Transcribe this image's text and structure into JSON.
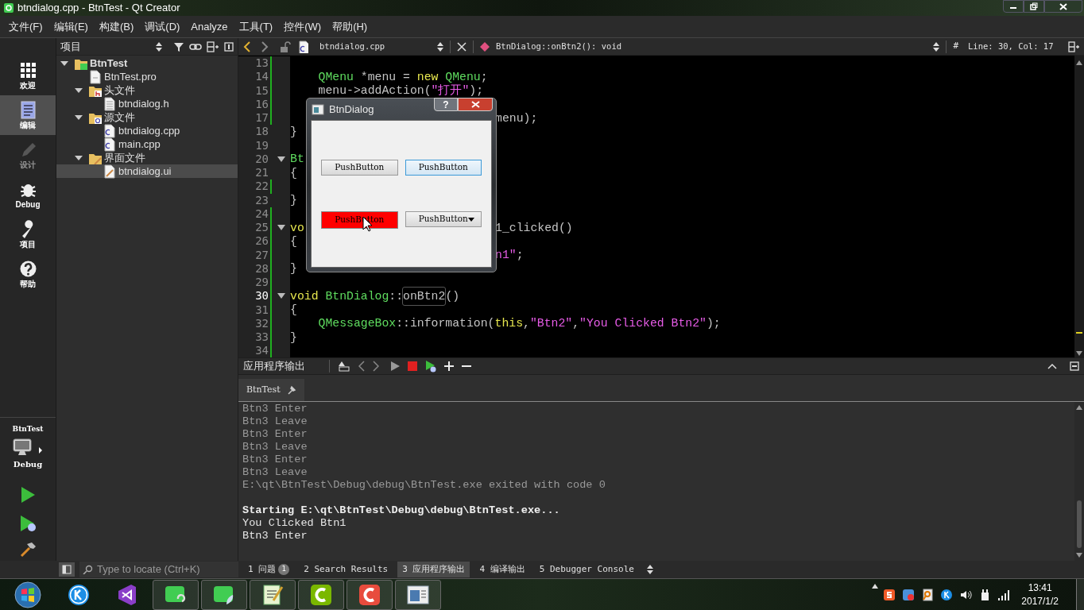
{
  "window": {
    "title": "btndialog.cpp - BtnTest - Qt Creator"
  },
  "menu": [
    "文件(F)",
    "编辑(E)",
    "构建(B)",
    "调试(D)",
    "Analyze",
    "工具(T)",
    "控件(W)",
    "帮助(H)"
  ],
  "mode_bar": {
    "items": [
      {
        "label": "欢迎",
        "kind": "welcome",
        "selected": false,
        "disabled": false
      },
      {
        "label": "编辑",
        "kind": "edit",
        "selected": true,
        "disabled": false
      },
      {
        "label": "设计",
        "kind": "design",
        "selected": false,
        "disabled": true
      },
      {
        "label": "Debug",
        "kind": "debug",
        "selected": false,
        "disabled": false
      },
      {
        "label": "项目",
        "kind": "projects",
        "selected": false,
        "disabled": false
      },
      {
        "label": "帮助",
        "kind": "help",
        "selected": false,
        "disabled": false
      }
    ],
    "target": {
      "project": "BtnTest",
      "config": "Debug"
    }
  },
  "project_panel": {
    "title": "项目",
    "tree": [
      {
        "label": "BtnTest",
        "kind": "project",
        "expanded": true,
        "selected": false,
        "children": [
          {
            "label": "BtnTest.pro",
            "kind": "pro",
            "selected": false
          },
          {
            "label": "头文件",
            "kind": "folder-h",
            "expanded": true,
            "selected": false,
            "children": [
              {
                "label": "btndialog.h",
                "kind": "header",
                "selected": false
              }
            ]
          },
          {
            "label": "源文件",
            "kind": "folder-cpp",
            "expanded": true,
            "selected": false,
            "children": [
              {
                "label": "btndialog.cpp",
                "kind": "cpp",
                "selected": false
              },
              {
                "label": "main.cpp",
                "kind": "cpp",
                "selected": false
              }
            ]
          },
          {
            "label": "界面文件",
            "kind": "folder-ui",
            "expanded": true,
            "selected": false,
            "children": [
              {
                "label": "btndialog.ui",
                "kind": "ui",
                "selected": true
              }
            ]
          }
        ]
      }
    ]
  },
  "editor": {
    "file": "btndialog.cpp",
    "symbol": "BtnDialog::onBtn2(): void",
    "hash": "#",
    "position": "Line: 30, Col: 17",
    "lines": [
      {
        "num": "13",
        "changed": true,
        "foldable": false,
        "current": false
      },
      {
        "num": "14",
        "changed": true,
        "foldable": false,
        "current": false,
        "indented": true,
        "tokens": [
          {
            "kind": "type",
            "text": "QMenu"
          },
          {
            "kind": "plain",
            "text": " *menu = "
          },
          {
            "kind": "keyword",
            "text": "new"
          },
          {
            "kind": "type",
            "text": " QMenu"
          },
          {
            "kind": "plain",
            "text": ";"
          }
        ]
      },
      {
        "num": "15",
        "changed": true,
        "foldable": false,
        "current": false,
        "indented": true,
        "tokens": [
          {
            "kind": "plain",
            "text": "menu->addAction("
          },
          {
            "kind": "string",
            "text": "\"打开\""
          },
          {
            "kind": "plain",
            "text": ");"
          }
        ]
      },
      {
        "num": "16",
        "changed": true,
        "foldable": false,
        "current": false
      },
      {
        "num": "17",
        "changed": true,
        "foldable": false,
        "current": false,
        "after_dialog": [
          {
            "kind": "plain",
            "text": "menu);"
          }
        ]
      },
      {
        "num": "18",
        "changed": false,
        "foldable": false,
        "current": false,
        "tokens": [
          {
            "kind": "plain",
            "text": "}"
          }
        ]
      },
      {
        "num": "19",
        "changed": false,
        "foldable": false,
        "current": false
      },
      {
        "num": "20",
        "changed": false,
        "foldable": true,
        "current": false,
        "tokens": [
          {
            "kind": "type",
            "text": "Bt"
          }
        ]
      },
      {
        "num": "21",
        "changed": false,
        "foldable": false,
        "current": false,
        "tokens": [
          {
            "kind": "plain",
            "text": "{"
          }
        ]
      },
      {
        "num": "22",
        "changed": true,
        "foldable": false,
        "current": false
      },
      {
        "num": "23",
        "changed": false,
        "foldable": false,
        "current": false,
        "tokens": [
          {
            "kind": "plain",
            "text": "}"
          }
        ]
      },
      {
        "num": "24",
        "changed": true,
        "foldable": false,
        "current": false
      },
      {
        "num": "25",
        "changed": true,
        "foldable": true,
        "current": false,
        "tokens": [
          {
            "kind": "keyword",
            "text": "vo"
          }
        ],
        "after_dialog": [
          {
            "kind": "plain",
            "text": "1_clicked()"
          }
        ]
      },
      {
        "num": "26",
        "changed": true,
        "foldable": false,
        "current": false,
        "tokens": [
          {
            "kind": "plain",
            "text": "{"
          }
        ]
      },
      {
        "num": "27",
        "changed": true,
        "foldable": false,
        "current": false,
        "after_dialog": [
          {
            "kind": "string",
            "text": "n1\""
          },
          {
            "kind": "plain",
            "text": ";"
          }
        ]
      },
      {
        "num": "28",
        "changed": true,
        "foldable": false,
        "current": false,
        "tokens": [
          {
            "kind": "plain",
            "text": "}"
          }
        ]
      },
      {
        "num": "29",
        "changed": true,
        "foldable": false,
        "current": false
      },
      {
        "num": "30",
        "changed": true,
        "foldable": true,
        "current": true,
        "tokens": [
          {
            "kind": "keyword",
            "text": "void"
          },
          {
            "kind": "type",
            "text": " BtnDialog"
          },
          {
            "kind": "plain",
            "text": "::"
          },
          {
            "kind": "highlight",
            "text": "onBtn2"
          },
          {
            "kind": "plain",
            "text": "()"
          }
        ]
      },
      {
        "num": "31",
        "changed": true,
        "foldable": false,
        "current": false,
        "tokens": [
          {
            "kind": "plain",
            "text": "{"
          }
        ]
      },
      {
        "num": "32",
        "changed": true,
        "foldable": false,
        "current": false,
        "indented": true,
        "tokens": [
          {
            "kind": "type",
            "text": "QMessageBox"
          },
          {
            "kind": "plain",
            "text": "::information("
          },
          {
            "kind": "keyword",
            "text": "this"
          },
          {
            "kind": "plain",
            "text": ","
          },
          {
            "kind": "string",
            "text": "\"Btn2\""
          },
          {
            "kind": "plain",
            "text": ","
          },
          {
            "kind": "string",
            "text": "\"You Clicked Btn2\""
          },
          {
            "kind": "plain",
            "text": ");"
          }
        ]
      },
      {
        "num": "33",
        "changed": true,
        "foldable": false,
        "current": false,
        "tokens": [
          {
            "kind": "plain",
            "text": "}"
          }
        ]
      },
      {
        "num": "34",
        "changed": true,
        "foldable": false,
        "current": false
      }
    ]
  },
  "dialog": {
    "title": "BtnDialog",
    "help": "?",
    "buttons": [
      {
        "label": "PushButton",
        "kind": "plain",
        "focused": false
      },
      {
        "label": "PushButton",
        "kind": "plain",
        "focused": true
      },
      {
        "label": "PushButton",
        "kind": "colored",
        "color": "#ff0000",
        "focused": false
      },
      {
        "label": "PushButton",
        "kind": "menu",
        "focused": false
      }
    ]
  },
  "output": {
    "title": "应用程序输出",
    "tabs": [
      {
        "label": "BtnTest",
        "selected": true
      }
    ],
    "lines": [
      {
        "text": "Btn3 Enter",
        "kind": "old"
      },
      {
        "text": "Btn3 Leave",
        "kind": "old"
      },
      {
        "text": "Btn3 Enter",
        "kind": "old"
      },
      {
        "text": "Btn3 Leave",
        "kind": "old"
      },
      {
        "text": "Btn3 Enter",
        "kind": "old"
      },
      {
        "text": "Btn3 Leave",
        "kind": "old"
      },
      {
        "text": "E:\\qt\\BtnTest\\Debug\\debug\\BtnTest.exe exited with code 0",
        "kind": "old"
      },
      {
        "kind": "blank"
      },
      {
        "text": "Starting E:\\qt\\BtnTest\\Debug\\debug\\BtnTest.exe...",
        "kind": "start"
      },
      {
        "text": "You Clicked Btn1",
        "kind": "new"
      },
      {
        "text": "Btn3 Enter",
        "kind": "new"
      }
    ]
  },
  "status_bar": {
    "locate_placeholder": "Type to locate (Ctrl+K)",
    "panes": [
      {
        "num": "1",
        "label": "问题",
        "badge": "1",
        "selected": false
      },
      {
        "num": "2",
        "label": "Search Results",
        "selected": false
      },
      {
        "num": "3",
        "label": "应用程序输出",
        "selected": true
      },
      {
        "num": "4",
        "label": "编译输出",
        "selected": false
      },
      {
        "num": "5",
        "label": "Debugger Console",
        "selected": false
      }
    ]
  },
  "taskbar": {
    "apps": [
      {
        "kind": "k",
        "open": false
      },
      {
        "kind": "vs",
        "open": false
      },
      {
        "kind": "qt-help",
        "open": true
      },
      {
        "kind": "qt",
        "open": true
      },
      {
        "kind": "notepad",
        "open": true
      },
      {
        "kind": "cam-green",
        "open": true
      },
      {
        "kind": "cam-red",
        "open": true
      },
      {
        "kind": "window",
        "open": true
      }
    ],
    "tray": [
      {
        "kind": "sogou"
      },
      {
        "kind": "qq"
      },
      {
        "kind": "tool"
      },
      {
        "kind": "k"
      },
      {
        "kind": "volume"
      },
      {
        "kind": "power"
      },
      {
        "kind": "signal"
      }
    ],
    "time": "13:41",
    "date": "2017/1/2"
  }
}
